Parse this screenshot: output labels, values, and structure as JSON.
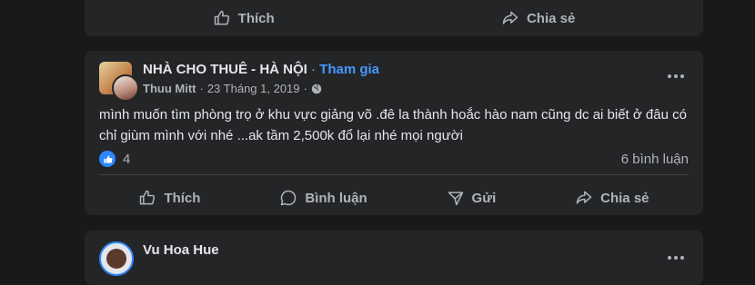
{
  "top_card": {
    "actions": [
      {
        "label": "Thích",
        "icon": "like-icon"
      },
      {
        "label": "Chia sẻ",
        "icon": "share-icon"
      }
    ]
  },
  "post": {
    "group_name": "NHÀ CHO THUÊ - HÀ NỘI",
    "separator": "·",
    "join_label": "Tham gia",
    "author": "Thuu Mitt",
    "meta_separator": "·",
    "date": "23 Tháng 1, 2019",
    "meta_separator2": "·",
    "privacy_icon": "globe-icon",
    "text": "mình muốn tìm phòng trọ ở khu vực giảng võ .đê la thành hoắc hào nam cũng dc ai biết ở đâu có chỉ giùm mình với nhé ...ak tầm 2,500k đổ lại nhé mọi người",
    "reaction_count": "4",
    "comments_count": "6 bình luận",
    "actions": [
      {
        "label": "Thích",
        "icon": "like-icon"
      },
      {
        "label": "Bình luận",
        "icon": "comment-icon"
      },
      {
        "label": "Gửi",
        "icon": "send-icon"
      },
      {
        "label": "Chia sẻ",
        "icon": "share-icon"
      }
    ]
  },
  "bottom_card": {
    "name": "Vu Hoa Hue"
  },
  "colors": {
    "background": "#18191a",
    "card": "#242526",
    "text": "#e4e6eb",
    "secondary_text": "#b0b3b8",
    "link": "#4599ff",
    "like_blue": "#2d88ff"
  }
}
